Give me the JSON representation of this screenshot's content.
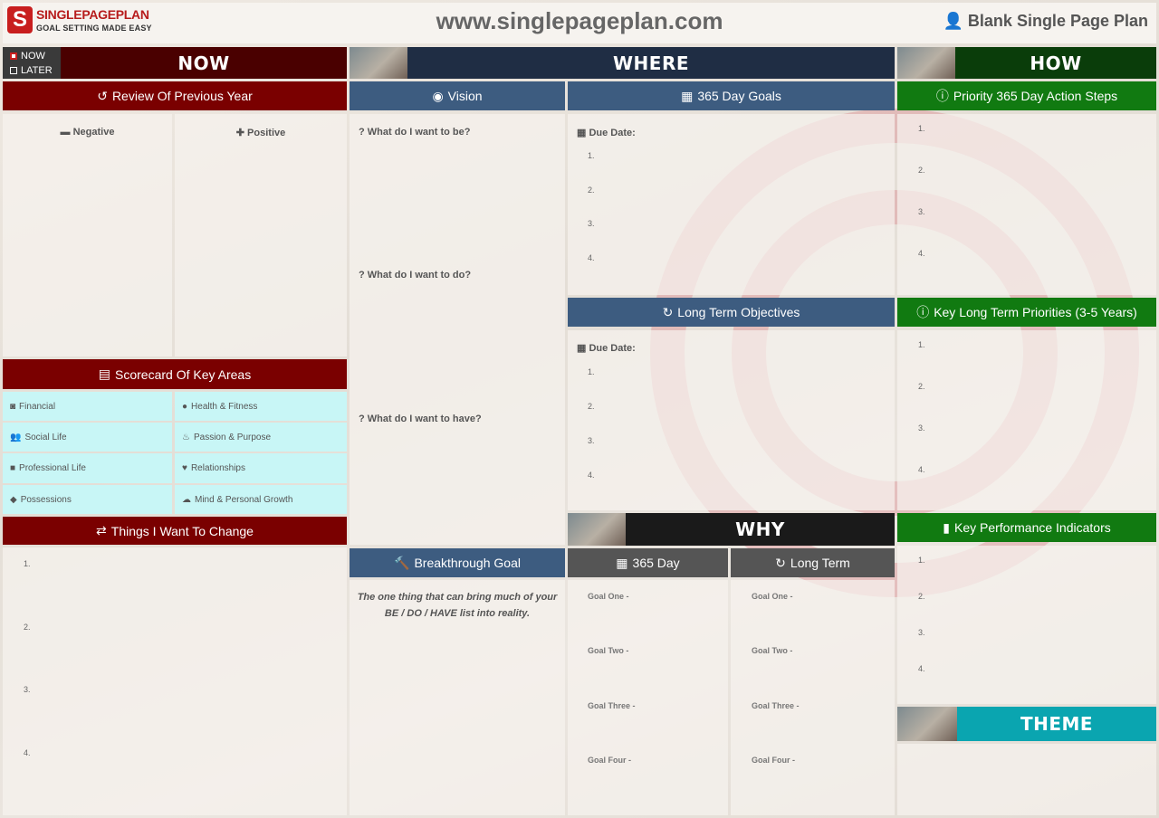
{
  "header": {
    "logo_main": "SINGLEPAGEPLAN",
    "logo_tag": "GOAL SETTING MADE EASY",
    "url": "www.singlepageplan.com",
    "plan_title": "Blank Single Page Plan"
  },
  "toggle": {
    "now": "NOW",
    "later": "LATER"
  },
  "sections": {
    "now": "NOW",
    "where": "WHERE",
    "how": "HOW",
    "why": "WHY",
    "theme": "THEME"
  },
  "now": {
    "review_title": "Review Of Previous Year",
    "negative": "Negative",
    "positive": "Positive",
    "scorecard_title": "Scorecard Of Key Areas",
    "scorecard": [
      "Financial",
      "Health & Fitness",
      "Social Life",
      "Passion & Purpose",
      "Professional Life",
      "Relationships",
      "Possessions",
      "Mind & Personal Growth"
    ],
    "change_title": "Things I Want To Change",
    "change_nums": [
      "1.",
      "2.",
      "3.",
      "4."
    ]
  },
  "where": {
    "vision_title": "Vision",
    "q_be": "What do I want to be?",
    "q_do": "What do I want to do?",
    "q_have": "What do I want to have?",
    "goals_title": "365 Day Goals",
    "due": "Due Date:",
    "goals_nums": [
      "1.",
      "2.",
      "3.",
      "4."
    ],
    "objectives_title": "Long Term Objectives",
    "objectives_nums": [
      "1.",
      "2.",
      "3.",
      "4."
    ],
    "breakthrough_title": "Breakthrough Goal",
    "breakthrough_text": "The one thing that can bring much of your BE / DO / HAVE list into reality."
  },
  "why": {
    "day_title": "365 Day",
    "long_title": "Long Term",
    "goals": [
      "Goal One -",
      "Goal Two -",
      "Goal Three -",
      "Goal Four -"
    ]
  },
  "how": {
    "action_title": "Priority 365 Day Action Steps",
    "action_nums": [
      "1.",
      "2.",
      "3.",
      "4."
    ],
    "priorities_title": "Key Long Term Priorities (3-5 Years)",
    "priorities_nums": [
      "1.",
      "2.",
      "3.",
      "4."
    ],
    "kpi_title": "Key Performance Indicators",
    "kpi_nums": [
      "1.",
      "2.",
      "3.",
      "4."
    ]
  },
  "colors": {
    "now": "#4a0000",
    "where": "#1f2d44",
    "how": "#0a3d0a",
    "why": "#1a1a1a",
    "theme": "#0aa5b0",
    "red": "#7a0000",
    "blue": "#3d5c80",
    "green": "#117a11",
    "grey": "#555555",
    "scorecard": "#c8f6f6"
  }
}
